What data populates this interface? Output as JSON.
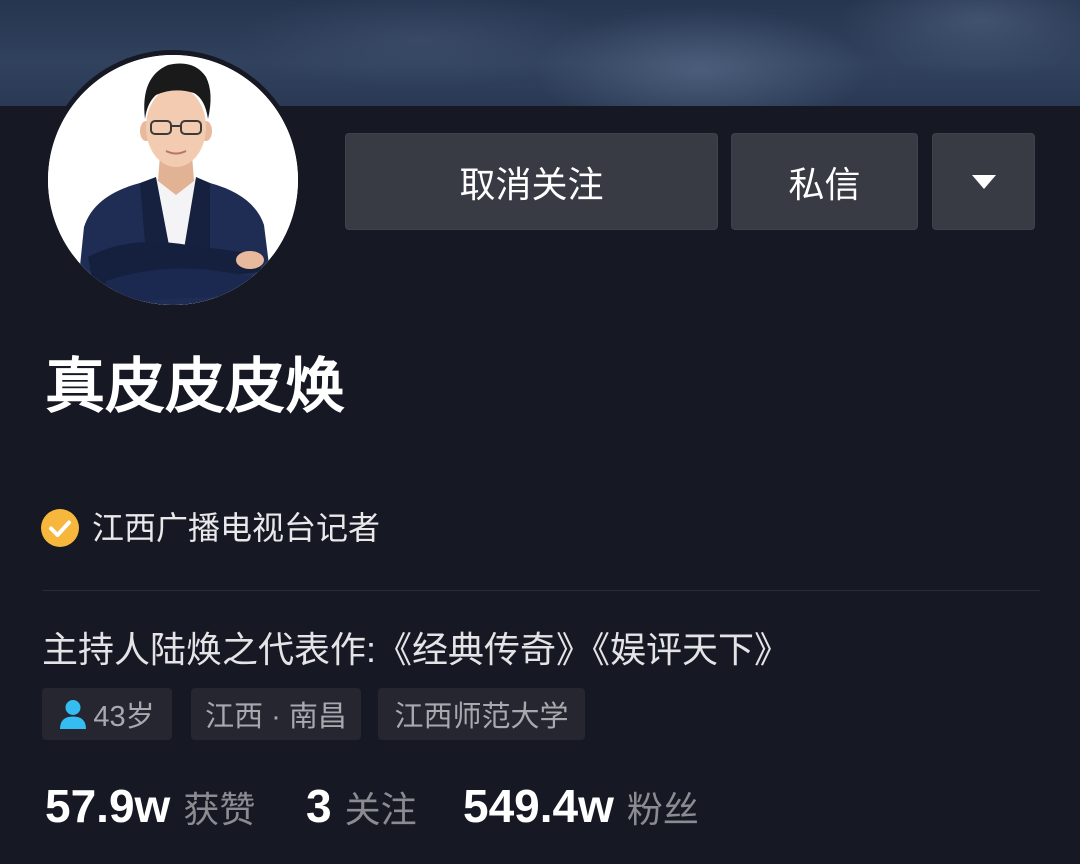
{
  "colors": {
    "background": "#161823",
    "button": "#393b44",
    "tag": "#25262f",
    "verified_badge": "#f6b73c",
    "age_icon": "#35bdf2",
    "secondary_text": "#8b8c92"
  },
  "actions": {
    "unfollow_label": "取消关注",
    "message_label": "私信",
    "more_icon": "caret-down-icon"
  },
  "profile": {
    "name": "真皮皮皮焕",
    "verification_icon": "verified-check-icon",
    "verification": "江西广播电视台记者",
    "bio": "主持人陆焕之代表作:《经典传奇》《娱评天下》"
  },
  "tags": [
    {
      "icon": "person-icon",
      "label": "43岁"
    },
    {
      "label": "江西 · 南昌"
    },
    {
      "label": "江西师范大学"
    }
  ],
  "stats": [
    {
      "value": "57.9w",
      "label": "获赞"
    },
    {
      "value": "3",
      "label": "关注"
    },
    {
      "value": "549.4w",
      "label": "粉丝"
    }
  ]
}
